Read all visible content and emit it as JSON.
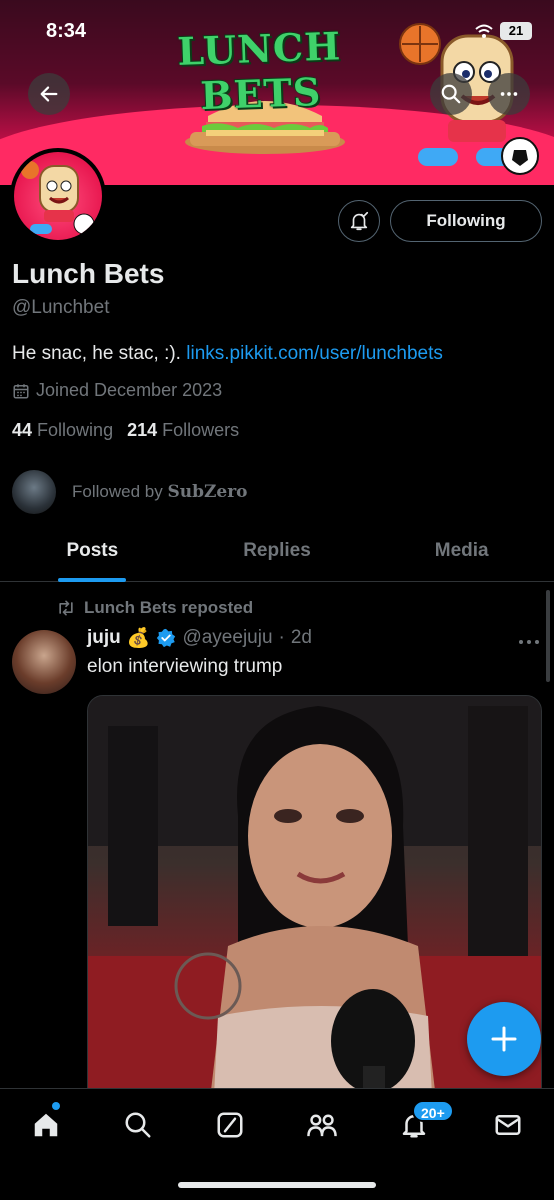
{
  "status_bar": {
    "time": "8:34",
    "battery": "21"
  },
  "banner": {
    "title": "LUNCH BETS"
  },
  "profile": {
    "display_name": "Lunch Bets",
    "handle": "@Lunchbet",
    "bio_text": "He snac, he stac, :). ",
    "bio_link": "links.pikkit.com/user/lunchbets",
    "joined": "Joined December 2023",
    "following_count": "44",
    "following_label": "Following",
    "followers_count": "214",
    "followers_label": "Followers",
    "followed_by_prefix": "Followed by",
    "followed_by_name": "SubZero",
    "follow_button_label": "Following"
  },
  "tabs": [
    {
      "label": "Posts",
      "active": true
    },
    {
      "label": "Replies",
      "active": false
    },
    {
      "label": "Media",
      "active": false
    }
  ],
  "post": {
    "repost_label": "Lunch Bets reposted",
    "author": "juju",
    "author_emoji": "💰",
    "handle": "@ayeejuju",
    "separator": "·",
    "age": "2d",
    "text": "elon interviewing trump"
  },
  "nav": {
    "notifications_badge": "20+"
  },
  "colors": {
    "accent": "#1d9bf0",
    "background": "#000000",
    "muted": "#71767b"
  }
}
